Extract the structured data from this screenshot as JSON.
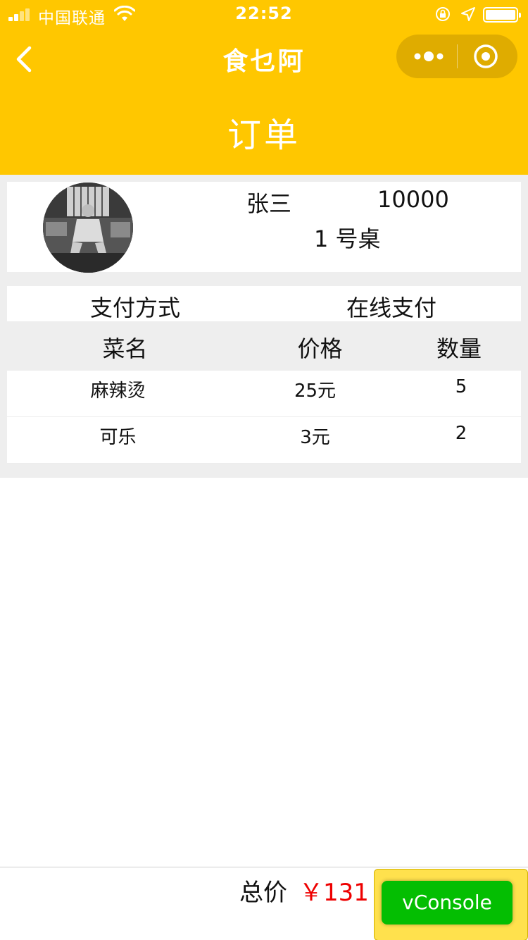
{
  "status_bar": {
    "carrier": "中国联通",
    "time": "22:52"
  },
  "nav": {
    "title": "食乜阿"
  },
  "page": {
    "heading": "订单"
  },
  "user": {
    "name": "张三",
    "id": "10000",
    "table": "1 号桌"
  },
  "payment": {
    "label": "支付方式",
    "value": "在线支付"
  },
  "table": {
    "headers": {
      "name": "菜名",
      "price": "价格",
      "qty": "数量"
    },
    "rows": [
      {
        "name": "麻辣烫",
        "price": "25元",
        "qty": "5"
      },
      {
        "name": "可乐",
        "price": "3元",
        "qty": "2"
      }
    ]
  },
  "footer": {
    "total_label": "总价",
    "total_value": "￥131"
  },
  "vconsole": {
    "label": "vConsole"
  },
  "colors": {
    "header": "#ffc700",
    "price_red": "#ee0000",
    "vconsole_green": "#04be02"
  }
}
